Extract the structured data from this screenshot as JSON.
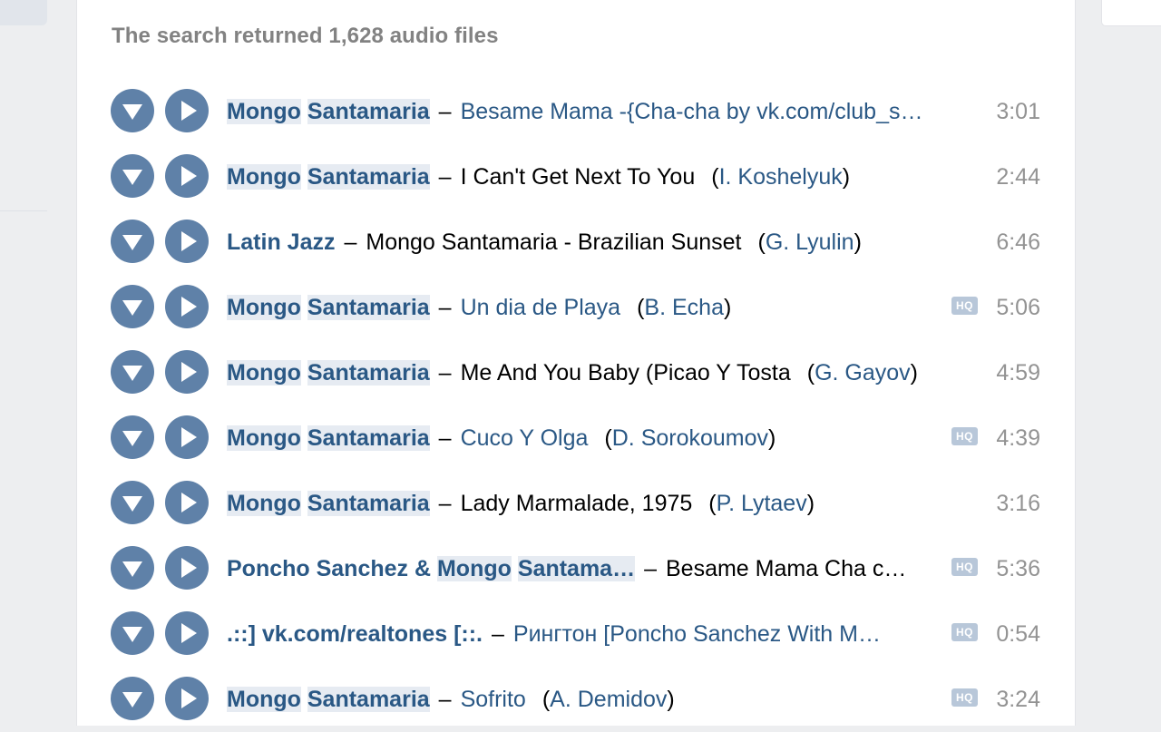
{
  "summary": "The search returned 1,628 audio files",
  "colors": {
    "accent": "#2a5885",
    "button": "#5f81a8",
    "hq_badge": "#b8c7d9",
    "duration": "#939393"
  },
  "icons": {
    "add": "down-triangle-icon",
    "play": "play-icon"
  },
  "tracks": [
    {
      "artist": [
        "Mongo",
        " ",
        "Santamaria"
      ],
      "artist_hl": true,
      "title": "Besame Mama -{Cha-cha by vk.com/club_s…",
      "title_link": true,
      "uploader": "",
      "hq": "",
      "duration": "3:01"
    },
    {
      "artist": [
        "Mongo",
        " ",
        "Santamaria"
      ],
      "artist_hl": true,
      "title": "I Can't Get Next To You",
      "title_link": false,
      "uploader": "I. Koshelyuk",
      "hq": "",
      "duration": "2:44"
    },
    {
      "artist": [
        "Latin Jazz"
      ],
      "artist_hl": false,
      "title": "Mongo Santamaria - Brazilian Sunset",
      "title_link": false,
      "uploader": "G. Lyulin",
      "hq": "",
      "duration": "6:46"
    },
    {
      "artist": [
        "Mongo",
        " ",
        "Santamaria"
      ],
      "artist_hl": true,
      "title": "Un dia de Playa",
      "title_link": true,
      "uploader": "B. Echa",
      "hq": "HQ",
      "duration": "5:06"
    },
    {
      "artist": [
        "Mongo",
        " ",
        "Santamaria"
      ],
      "artist_hl": true,
      "title": "Me And You Baby (Picao Y Tosta",
      "title_link": false,
      "uploader": "G. Gayov",
      "hq": "",
      "duration": "4:59"
    },
    {
      "artist": [
        "Mongo",
        " ",
        "Santamaria"
      ],
      "artist_hl": true,
      "title": "Cuco Y Olga",
      "title_link": true,
      "uploader": "D. Sorokoumov",
      "hq": "HQ",
      "duration": "4:39"
    },
    {
      "artist": [
        "Mongo",
        " ",
        "Santamaria"
      ],
      "artist_hl": true,
      "title": "Lady Marmalade, 1975",
      "title_link": false,
      "uploader": "P. Lytaev",
      "hq": "",
      "duration": "3:16"
    },
    {
      "artist": [
        "Poncho Sanchez & ",
        "Mongo",
        " ",
        "Santama…"
      ],
      "artist_hl": "mixed",
      "title": "Besame Mama Cha c…",
      "title_link": false,
      "uploader": "",
      "hq": "HQ",
      "duration": "5:36"
    },
    {
      "artist": [
        ".::] vk.com/realtones [::."
      ],
      "artist_hl": false,
      "title": "Рингтон [Poncho Sanchez With M…",
      "title_link": true,
      "uploader": "",
      "hq": "HQ",
      "duration": "0:54"
    },
    {
      "artist": [
        "Mongo",
        " ",
        "Santamaria"
      ],
      "artist_hl": true,
      "title": "Sofrito",
      "title_link": true,
      "uploader": "A. Demidov",
      "hq": "HQ",
      "duration": "3:24"
    }
  ]
}
